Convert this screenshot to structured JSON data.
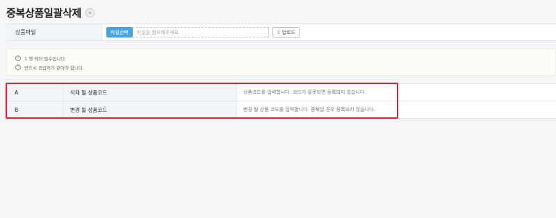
{
  "header": {
    "title": "중복상품일괄삭제",
    "favorite_icon": "star-icon"
  },
  "upload": {
    "label": "상품파일",
    "select_button": "파일선택",
    "file_placeholder": "파일을 첨부해주세요.",
    "upload_button": "업로드",
    "upload_icon": "upload-icon"
  },
  "notices": [
    {
      "icon": "info-icon",
      "text": "1 행 헤더 필수입니다."
    },
    {
      "icon": "info-icon",
      "text": "반드시 공급처가 같아야 합니다."
    }
  ],
  "rows": [
    {
      "column": "A",
      "name": "삭제 될 상품코드",
      "description": "상품코드를 입력합니다. 코드가 잘못되면 등록되지 않습니다"
    },
    {
      "column": "B",
      "name": "변경 될 상품코드",
      "description": "변경 될 상품 코드를 입력합니다. 중복일 경우 등록되지 않습니다."
    }
  ],
  "colors": {
    "accent": "#4aa3df",
    "highlight": "#d9232f",
    "label_bg": "#f1f5fa"
  }
}
